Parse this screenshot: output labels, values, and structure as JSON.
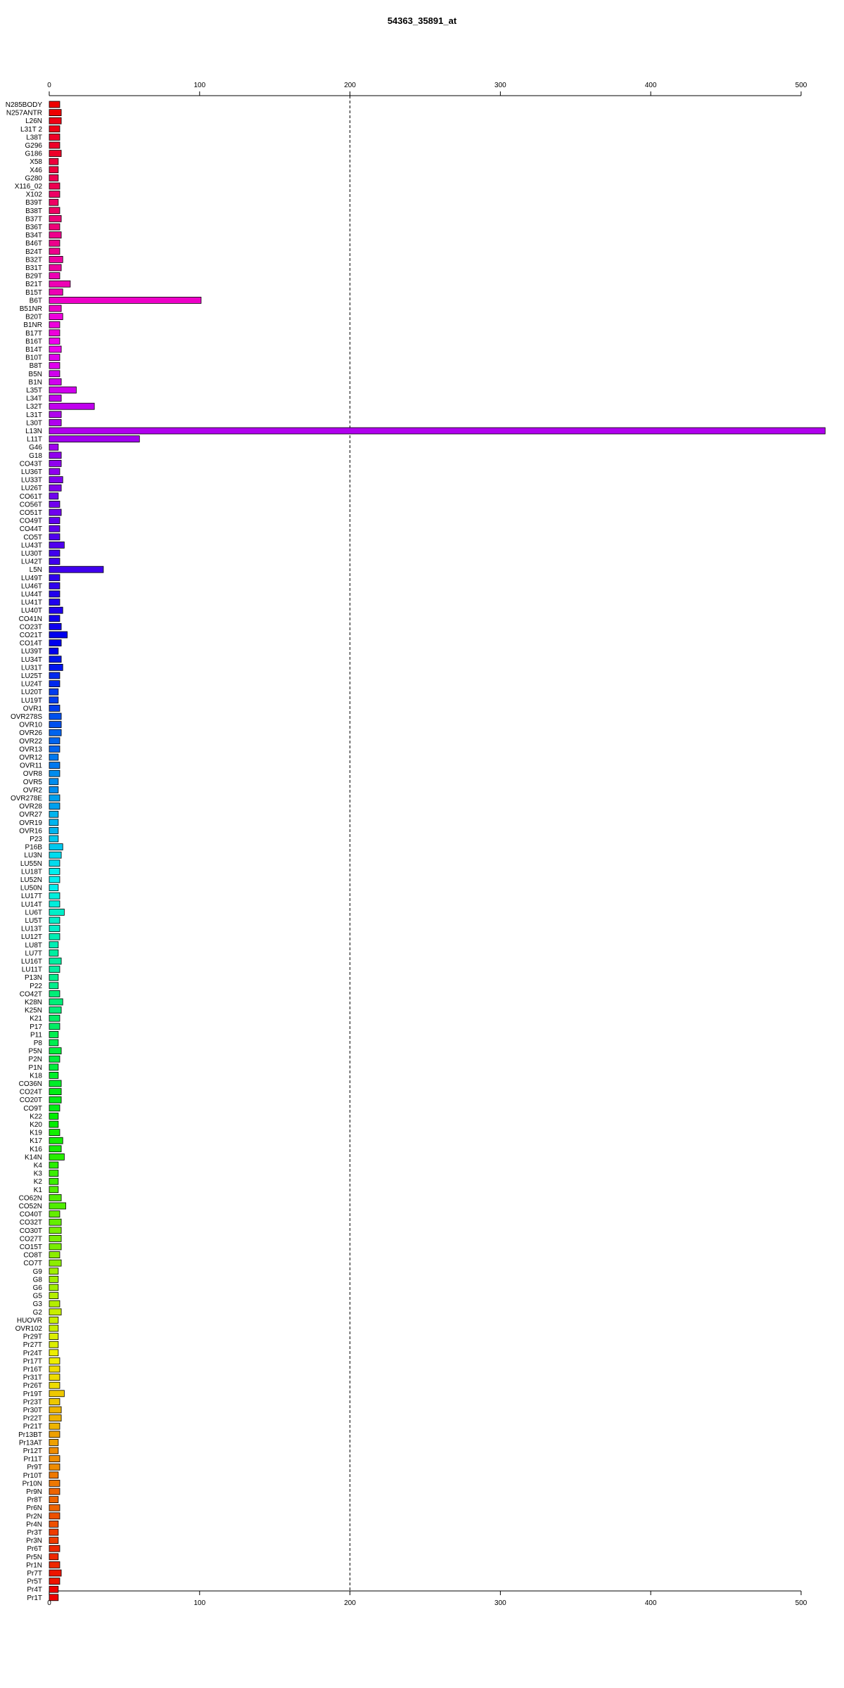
{
  "chart_data": {
    "type": "bar",
    "orientation": "horizontal",
    "title": "54363_35891_at",
    "xlim": [
      0,
      500
    ],
    "xticks": [
      0,
      100,
      200,
      300,
      400,
      500
    ],
    "tick_labels": [
      "0",
      "100",
      "200",
      "300",
      "400",
      "500"
    ],
    "reference_line": 200,
    "xlabel": "",
    "ylabel": "",
    "categories": [
      "N285BODY",
      "N257ANTR",
      "L26N",
      "L31T 2",
      "L38T",
      "G296",
      "G186",
      "X58",
      "X46",
      "G280",
      "X116_02",
      "X102",
      "B39T",
      "B38T",
      "B37T",
      "B36T",
      "B34T",
      "B46T",
      "B24T",
      "B32T",
      "B31T",
      "B29T",
      "B21T",
      "B15T",
      "B6T",
      "B51NR",
      "B20T",
      "B1NR",
      "B17T",
      "B16T",
      "B14T",
      "B10T",
      "B8T",
      "B5N",
      "B1N",
      "L35T",
      "L34T",
      "L32T",
      "L31T",
      "L30T",
      "L13N",
      "L11T",
      "G46",
      "G18",
      "CO43T",
      "LU36T",
      "LU33T",
      "LU26T",
      "CO61T",
      "CO56T",
      "CO51T",
      "CO49T",
      "CO44T",
      "CO5T",
      "LU43T",
      "LU30T",
      "LU42T",
      "L5N",
      "LU49T",
      "LU46T",
      "LU44T",
      "LU41T",
      "LU40T",
      "CO41N",
      "CO23T",
      "CO21T",
      "CO14T",
      "LU39T",
      "LU34T",
      "LU31T",
      "LU25T",
      "LU24T",
      "LU20T",
      "LU19T",
      "OVR1",
      "OVR278S",
      "OVR10",
      "OVR26",
      "OVR22",
      "OVR13",
      "OVR12",
      "OVR11",
      "OVR8",
      "OVR5",
      "OVR2",
      "OVR278E",
      "OVR28",
      "OVR27",
      "OVR19",
      "OVR16",
      "P23",
      "P16B",
      "LU3N",
      "LU55N",
      "LU18T",
      "LU52N",
      "LU50N",
      "LU17T",
      "LU14T",
      "LU6T",
      "LU5T",
      "LU13T",
      "LU12T",
      "LU8T",
      "LU7T",
      "LU16T",
      "LU11T",
      "P13N",
      "P22",
      "CO42T",
      "K28N",
      "K25N",
      "K21",
      "P17",
      "P11",
      "P8",
      "P5N",
      "P2N",
      "P1N",
      "K18",
      "CO36N",
      "CO24T",
      "CO20T",
      "CO9T",
      "K22",
      "K20",
      "K19",
      "K17",
      "K16",
      "K14N",
      "K4",
      "K3",
      "K2",
      "K1",
      "CO62N",
      "CO52N",
      "CO40T",
      "CO32T",
      "CO30T",
      "CO27T",
      "CO15T",
      "CO8T",
      "CO7T",
      "G9",
      "G8",
      "G6",
      "G5",
      "G3",
      "G2",
      "HUOVR",
      "OVR102",
      "Pr29T",
      "Pr27T",
      "Pr24T",
      "Pr17T",
      "Pr16T",
      "Pr31T",
      "Pr26T",
      "Pr19T",
      "Pr23T",
      "Pr30T",
      "Pr22T",
      "Pr21T",
      "Pr13BT",
      "Pr13AT",
      "Pr12T",
      "Pr11T",
      "Pr9T",
      "Pr10T",
      "Pr10N",
      "Pr9N",
      "Pr8T",
      "Pr6N",
      "Pr2N",
      "Pr4N",
      "Pr3T",
      "Pr3N",
      "Pr6T",
      "Pr5N",
      "Pr1N",
      "Pr7T",
      "Pr5T",
      "Pr4T",
      "Pr1T"
    ],
    "values": [
      7,
      8,
      8,
      7,
      7,
      7,
      8,
      6,
      6,
      6,
      7,
      7,
      6,
      7,
      8,
      7,
      8,
      7,
      7,
      9,
      8,
      7,
      14,
      9,
      101,
      8,
      9,
      7,
      7,
      7,
      8,
      7,
      7,
      7,
      8,
      18,
      8,
      30,
      8,
      8,
      516,
      60,
      6,
      8,
      8,
      7,
      9,
      8,
      6,
      7,
      8,
      7,
      7,
      7,
      10,
      7,
      7,
      36,
      7,
      7,
      7,
      7,
      9,
      7,
      8,
      12,
      8,
      6,
      8,
      9,
      7,
      7,
      6,
      6,
      7,
      8,
      8,
      8,
      7,
      7,
      6,
      7,
      7,
      6,
      6,
      7,
      7,
      6,
      6,
      6,
      6,
      9,
      8,
      7,
      7,
      7,
      6,
      7,
      7,
      10,
      7,
      7,
      7,
      6,
      6,
      8,
      7,
      6,
      6,
      7,
      9,
      8,
      7,
      7,
      6,
      6,
      8,
      7,
      6,
      6,
      8,
      8,
      8,
      7,
      6,
      6,
      7,
      9,
      8,
      10,
      6,
      6,
      6,
      6,
      8,
      11,
      7,
      8,
      8,
      8,
      8,
      7,
      8,
      6,
      6,
      6,
      6,
      7,
      8,
      6,
      6,
      6,
      6,
      6,
      7,
      7,
      7,
      7,
      10,
      7,
      8,
      8,
      7,
      7,
      6,
      6,
      7,
      7,
      6,
      7,
      7,
      6,
      7,
      7,
      6,
      6,
      6,
      7,
      6,
      7,
      8,
      7,
      6,
      6,
      6,
      6,
      5
    ],
    "colors": [
      "#EE0000",
      "#EE0014",
      "#EE0028",
      "#EE003C",
      "#EE0050",
      "#EE0064",
      "#EE0078",
      "#EE008C",
      "#EE00A0",
      "#EE00B4",
      "#EE00C8",
      "#EE00DC",
      "#EE00EE",
      "#E000EE",
      "#D000EE",
      "#C000EE",
      "#B000EE",
      "#A000EE",
      "#9000EE",
      "#8000EE",
      "#7000EE",
      "#6000EE",
      "#5000EE",
      "#4000EE",
      "#3000EE",
      "#2000EE",
      "#1000EE",
      "#0000EE",
      "#0014EE",
      "#0028EE",
      "#003CEE",
      "#0050EE",
      "#0064EE",
      "#0078EE",
      "#008CEE",
      "#00A0EE",
      "#00B4EE",
      "#00C8EE",
      "#00DCEE",
      "#00EEEE",
      "#00EEDC",
      "#00EEC8",
      "#00EEB4",
      "#00EEA0",
      "#00EE8C",
      "#00EE78",
      "#00EE64",
      "#00EE50",
      "#00EE3C",
      "#00EE28",
      "#00EE14",
      "#00EE00",
      "#14EE00",
      "#28EE00",
      "#3CEE00",
      "#50EE00",
      "#64EE00",
      "#78EE00",
      "#8CEE00",
      "#A0EE00",
      "#B4EE00",
      "#C8EE00",
      "#DCEE00",
      "#EEEE00",
      "#EEDC00",
      "#EEC800",
      "#EEB400",
      "#EEA000",
      "#EE8C00",
      "#EE7800",
      "#EE6400",
      "#EE5000",
      "#EE3C00",
      "#EE2800",
      "#EE1400",
      "#EE0000"
    ],
    "grid": false,
    "legend": "none"
  }
}
